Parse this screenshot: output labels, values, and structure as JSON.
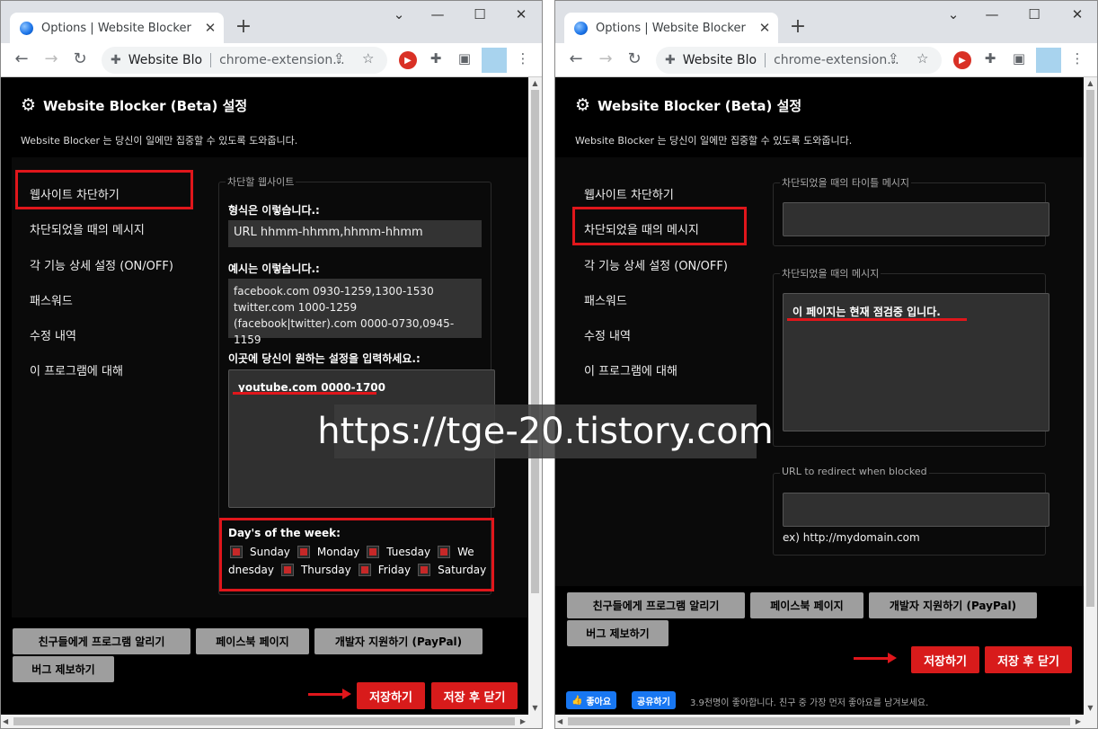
{
  "left": {
    "tab_title_a": "Options",
    "tab_title_b": " | Website Blocker",
    "omni_site": "Website Blo",
    "omni_url": "chrome-extension...",
    "heading": "Website Blocker (Beta) 설정",
    "subtitle": "Website Blocker 는 당신이 일에만 집중할 수 있도록 도와줍니다.",
    "nav": [
      "웹사이트 차단하기",
      "차단되었을 때의 메시지",
      "각 기능 상세 설정 (ON/OFF)",
      "패스워드",
      "수정 내역",
      "이 프로그램에 대해"
    ],
    "legend": "차단할 웹사이트",
    "format_label": "형식은 이렇습니다.:",
    "format_value": "URL hhmm-hhmm,hhmm-hhmm",
    "example_label": "예시는 이렇습니다.:",
    "example_lines": [
      "facebook.com 0930-1259,1300-1530",
      "twitter.com 1000-1259",
      "(facebook|twitter).com 0000-0730,0945-1159"
    ],
    "input_label": "이곳에 당신이 원하는 설정을 입력하세요.:",
    "input_value": "youtube.com 0000-1700",
    "days_label": "Day's of the week:",
    "days_row1": [
      "Sunday",
      "Monday",
      "Tuesday",
      "We"
    ],
    "days_row2_lead": "dnesday",
    "days_row2": [
      "Thursday",
      "Friday",
      "Saturday"
    ],
    "btn_share": "친구들에게 프로그램 알리기",
    "btn_facebook": "페이스북 페이지",
    "btn_paypal": "개발자 지원하기 (PayPal)",
    "btn_bug": "버그 제보하기",
    "btn_save": "저장하기",
    "btn_save_close": "저장 후 닫기"
  },
  "right": {
    "tab_title": "Options | Website Blocker",
    "omni_site": "Website Blo",
    "omni_url": "chrome-extension...",
    "heading": "Website Blocker (Beta) 설정",
    "subtitle": "Website Blocker 는 당신이 일에만 집중할 수 있도록 도와줍니다.",
    "nav": [
      "웹사이트 차단하기",
      "차단되었을 때의 메시지",
      "각 기능 상세 설정 (ON/OFF)",
      "패스워드",
      "수정 내역",
      "이 프로그램에 대해"
    ],
    "title_legend": "차단되었을 때의 타이틀 메시지",
    "title_value": "",
    "msg_legend": "차단되었을 때의 메시지",
    "msg_value": "이 페이지는 현재 점검중 입니다.",
    "redirect_legend": "URL to redirect when blocked",
    "redirect_value": "",
    "redirect_hint": "ex) http://mydomain.com",
    "btn_share": "친구들에게 프로그램 알리기",
    "btn_facebook": "페이스북 페이지",
    "btn_paypal": "개발자 지원하기 (PayPal)",
    "btn_bug": "버그 제보하기",
    "btn_save": "저장하기",
    "btn_save_close": "저장 후 닫기",
    "fb_like": "좋아요",
    "fb_share": "공유하기",
    "fb_text": "3.9천명이 좋아합니다. 친구 중 가장 먼저 좋아요를 남겨보세요."
  },
  "watermark": "https://tge-20.tistory.com",
  "colors": {
    "highlight": "#e0161b",
    "save_button": "#d81b1b",
    "checkbox_mark": "#c62828"
  },
  "icons": [
    "puzzle-icon",
    "gear-icon",
    "record-icon",
    "sidepanel-icon",
    "star-icon",
    "share-icon",
    "back-icon",
    "forward-icon",
    "reload-icon"
  ]
}
